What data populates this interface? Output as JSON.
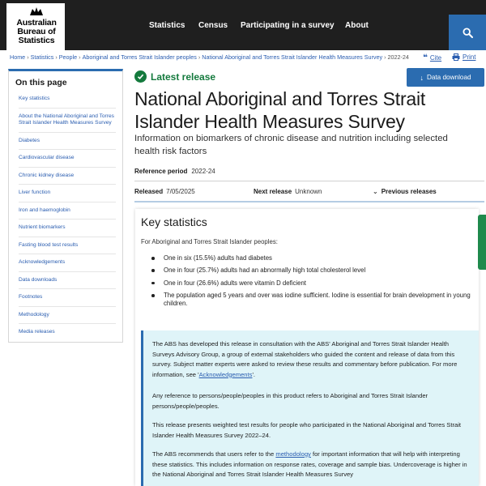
{
  "header": {
    "logo_lines": [
      "Australian",
      "Bureau of",
      "Statistics"
    ],
    "nav": [
      "Statistics",
      "Census",
      "Participating in a survey",
      "About"
    ]
  },
  "breadcrumb": {
    "items": [
      "Home",
      "Statistics",
      "People",
      "Aboriginal and Torres Strait Islander peoples",
      "National Aboriginal and Torres Strait Islander Health Measures Survey"
    ],
    "current": "2022-24"
  },
  "utility": {
    "cite": "Cite",
    "print": "Print"
  },
  "sidebar": {
    "title": "On this page",
    "items": [
      "Key statistics",
      "About the National Aboriginal and Torres Strait Islander Health Measures Survey",
      "Diabetes",
      "Cardiovascular disease",
      "Chronic kidney disease",
      "Liver function",
      "Iron and haemoglobin",
      "Nutrient biomarkers",
      "Fasting blood test results",
      "Acknowledgements",
      "Data downloads",
      "Footnotes",
      "Methodology",
      "Media releases"
    ]
  },
  "release": {
    "badge": "Latest release",
    "download": "Data download",
    "title": "National Aboriginal and Torres Strait Islander Health Measures Survey",
    "subtitle": "Information on biomarkers of chronic disease and nutrition including selected health risk factors",
    "reference_label": "Reference period",
    "reference_value": "2022-24",
    "released_label": "Released",
    "released_value": "7/05/2025",
    "next_label": "Next release",
    "next_value": "Unknown",
    "previous": "Previous releases"
  },
  "key_statistics": {
    "title": "Key statistics",
    "intro": "For Aboriginal and Torres Strait Islander peoples:",
    "items": [
      "One in six (15.5%) adults had diabetes",
      "One in four (25.7%) adults had an abnormally high total cholesterol level",
      "One in four (26.6%) adults were vitamin D deficient",
      "The population aged 5 years and over was iodine sufficient. Iodine is essential for brain development in young children."
    ]
  },
  "note": {
    "p1_start": "The ABS has developed this release in consultation with the ABS' Aboriginal and Torres Strait Islander Health Surveys Advisory Group, a group of external stakeholders who guided the content and release of data from this survey. Subject matter experts were asked to review these results and commentary before publication. For more information, see '",
    "p1_link": "Acknowledgements",
    "p1_end": "'.",
    "p2": "Any reference to persons/people/peoples in this product refers to Aboriginal and Torres Strait Islander persons/people/peoples.",
    "p3": "This release presents weighted test results for people who participated in the National Aboriginal and Torres Strait Islander Health Measures Survey 2022–24.",
    "p4_start": "The ABS recommends that users refer to the ",
    "p4_link": "methodology",
    "p4_end": " for important information that will help with interpreting these statistics. This includes information on response rates, coverage and sample bias. Undercoverage is higher in the National Aboriginal and Torres Strait Islander Health Measures Survey"
  },
  "colors": {
    "brand_blue": "#2b6cb0",
    "header_bg": "#1f1f1f",
    "success_green": "#147a3d",
    "note_bg": "#dff4f8"
  }
}
